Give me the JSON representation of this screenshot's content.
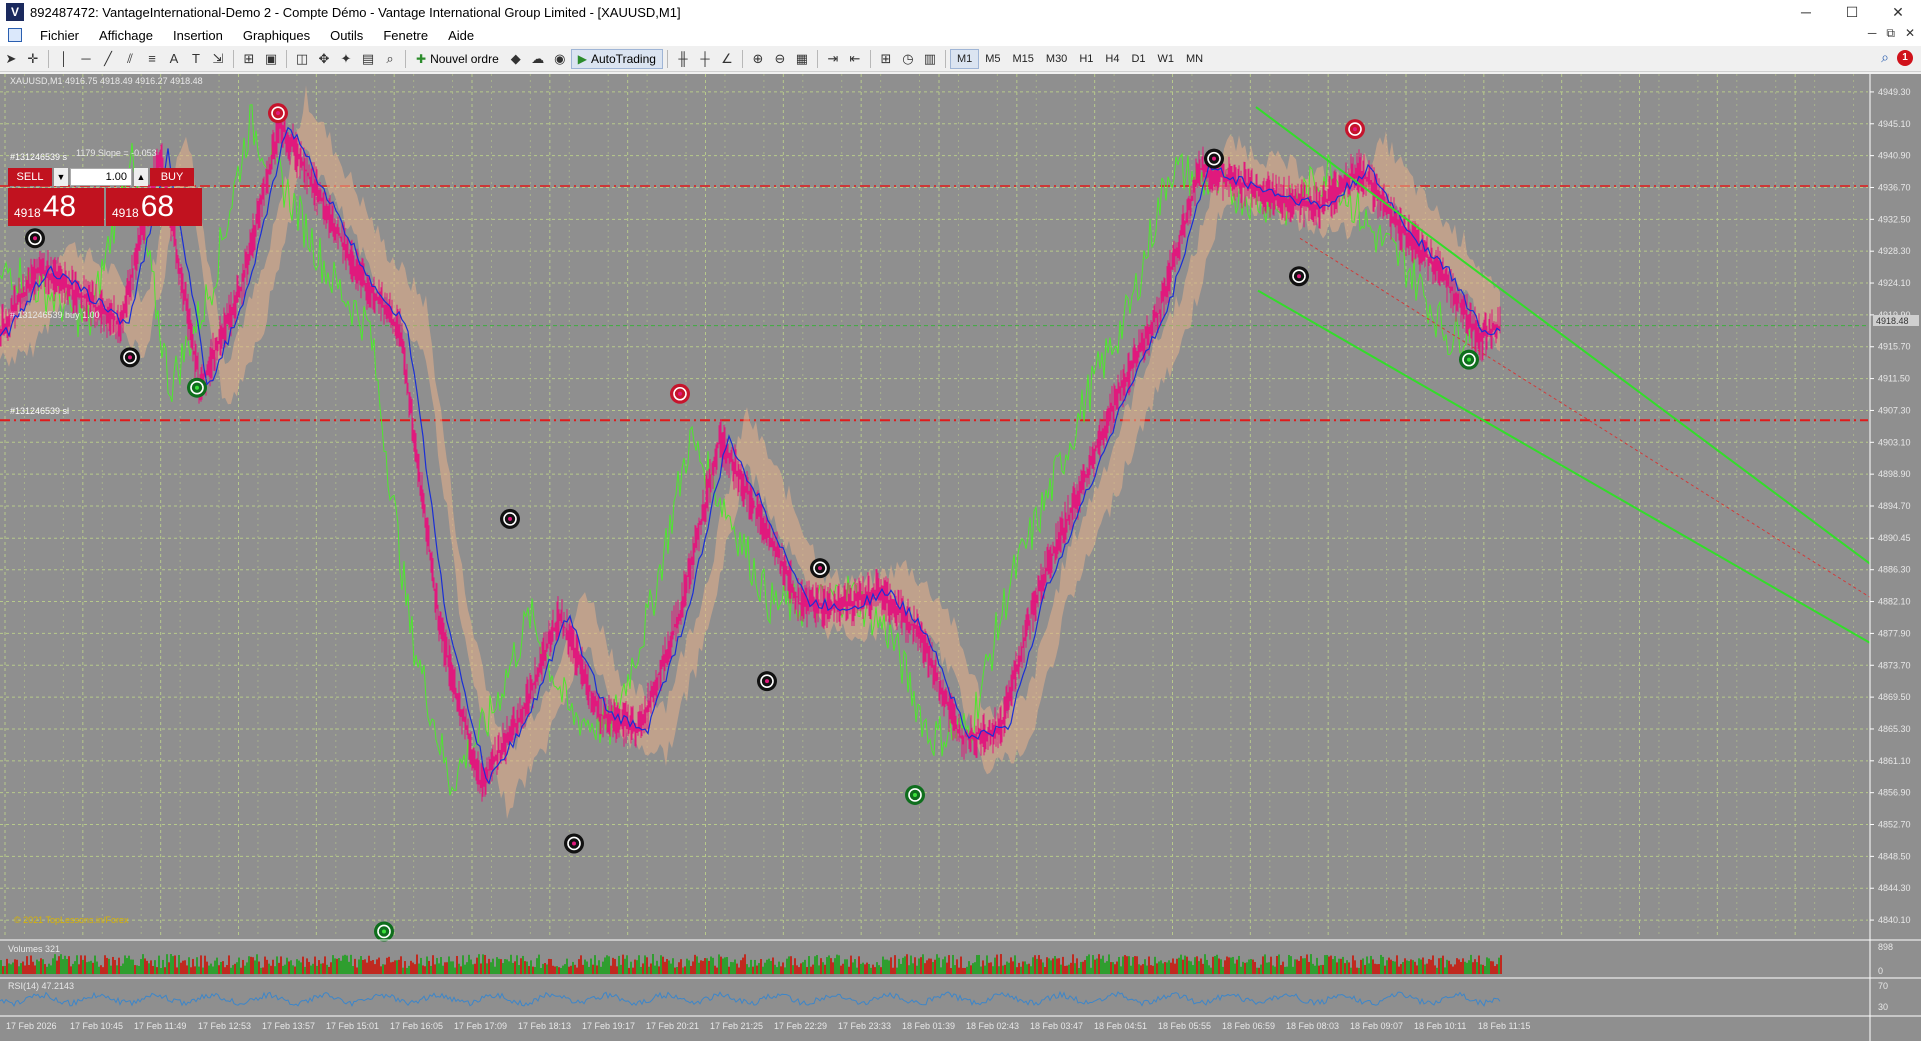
{
  "window": {
    "title": "892487472: VantageInternational-Demo 2 - Compte Démo - Vantage International Group Limited - [XAUUSD,M1]",
    "app_icon_letter": "V",
    "minimize": "─",
    "maximize": "☐",
    "close": "✕"
  },
  "menu": {
    "items": [
      "Fichier",
      "Affichage",
      "Insertion",
      "Graphiques",
      "Outils",
      "Fenetre",
      "Aide"
    ],
    "mdi": [
      "─",
      "⧉",
      "✕"
    ]
  },
  "toolbar": {
    "new_order": "Nouvel ordre",
    "autotrading": "AutoTrading",
    "timeframes": [
      "M1",
      "M5",
      "M15",
      "M30",
      "H1",
      "H4",
      "D1",
      "W1",
      "MN"
    ],
    "active_timeframe": "M1",
    "alert_count": "1"
  },
  "chart": {
    "header": "XAUUSD,M1  4916.75 4918.49 4916.27 4918.48",
    "trend_info": "1179 Slope = -0.053",
    "level_label_1": "#131246539 s",
    "level_label_2": "#131246539 sl",
    "mid_label": "# 131246539 buy 1.00",
    "copyright": "© 2021 TopLessons.in/Forex",
    "current_price_tag": "4918.48",
    "volumes_label": "Volumes 321",
    "rsi_label": "RSI(14) 47.2143",
    "volumes_scale": [
      "898",
      "0"
    ],
    "rsi_scale": [
      "70",
      "30"
    ]
  },
  "trade_panel": {
    "sell_label": "SELL",
    "buy_label": "BUY",
    "lot": "1.00",
    "sell_small": "4918",
    "sell_big": "48",
    "buy_small": "4918",
    "buy_big": "68"
  },
  "chart_data": {
    "type": "line",
    "symbol": "XAUUSD",
    "timeframe": "M1",
    "y_ticks": [
      "4949.30",
      "4945.10",
      "4940.90",
      "4936.70",
      "4932.50",
      "4928.30",
      "4924.10",
      "4919.90",
      "4915.70",
      "4911.50",
      "4907.30",
      "4903.10",
      "4898.90",
      "4894.70",
      "4890.45",
      "4886.30",
      "4882.10",
      "4877.90",
      "4873.70",
      "4869.50",
      "4865.30",
      "4861.10",
      "4856.90",
      "4852.70",
      "4848.50",
      "4844.30",
      "4840.10"
    ],
    "x_ticks": [
      "17 Feb 2026",
      "17 Feb 10:45",
      "17 Feb 11:49",
      "17 Feb 12:53",
      "17 Feb 13:57",
      "17 Feb 15:01",
      "17 Feb 16:05",
      "17 Feb 17:09",
      "17 Feb 18:13",
      "17 Feb 19:17",
      "17 Feb 20:21",
      "17 Feb 21:25",
      "17 Feb 22:29",
      "17 Feb 23:33",
      "18 Feb 01:39",
      "18 Feb 02:43",
      "18 Feb 03:47",
      "18 Feb 04:51",
      "18 Feb 05:55",
      "18 Feb 06:59",
      "18 Feb 08:03",
      "18 Feb 09:07",
      "18 Feb 10:11",
      "18 Feb 11:15"
    ],
    "ylim": [
      4838.0,
      4951.4
    ],
    "colors": {
      "background": "#8f8f8f",
      "grid": "#b7c98b",
      "price": "#e0197d",
      "ma": "#1a2fd6",
      "chikou": "#4de82d",
      "channel": "#33dd2a",
      "sl_line": "#e01b1b",
      "volume_up": "#2f9e2f",
      "volume_down": "#c0291f",
      "rsi": "#3d86c9"
    },
    "series": [
      {
        "x": [
          0,
          40,
          80,
          120,
          160,
          200,
          240,
          280,
          320,
          360,
          400,
          440,
          480,
          520,
          560,
          600,
          640,
          680,
          720,
          760,
          800,
          840,
          880,
          920,
          960,
          1000,
          1040,
          1080,
          1120,
          1160,
          1200,
          1240,
          1280,
          1320,
          1360,
          1400,
          1440,
          1480,
          1500
        ],
        "values": [
          4917.7,
          4926.0,
          4922.6,
          4918.7,
          4941.2,
          4910.4,
          4923.0,
          4945.3,
          4935.4,
          4925.0,
          4918.0,
          4878.6,
          4858.2,
          4866.8,
          4880.3,
          4867.2,
          4865.3,
          4880.8,
          4903.6,
          4893.3,
          4881.9,
          4881.3,
          4883.4,
          4877.9,
          4864.2,
          4865.3,
          4884.4,
          4896.7,
          4910.1,
          4920.6,
          4939.3,
          4937.2,
          4935.4,
          4934.1,
          4939.2,
          4931.2,
          4925.8,
          4916.7,
          4918.5
        ]
      }
    ],
    "swing_markers": [
      {
        "x": 35,
        "y": 4930.0,
        "type": "black"
      },
      {
        "x": 130,
        "y": 4914.3,
        "type": "black"
      },
      {
        "x": 197,
        "y": 4910.3,
        "type": "green"
      },
      {
        "x": 278,
        "y": 4946.5,
        "type": "red"
      },
      {
        "x": 384,
        "y": 4838.6,
        "type": "green"
      },
      {
        "x": 510,
        "y": 4893.0,
        "type": "black"
      },
      {
        "x": 574,
        "y": 4850.2,
        "type": "black"
      },
      {
        "x": 680,
        "y": 4909.5,
        "type": "red"
      },
      {
        "x": 767,
        "y": 4871.6,
        "type": "black"
      },
      {
        "x": 820,
        "y": 4886.5,
        "type": "black"
      },
      {
        "x": 915,
        "y": 4856.6,
        "type": "green"
      },
      {
        "x": 1214,
        "y": 4940.5,
        "type": "black"
      },
      {
        "x": 1299,
        "y": 4925.0,
        "type": "black"
      },
      {
        "x": 1355,
        "y": 4944.4,
        "type": "red"
      },
      {
        "x": 1469,
        "y": 4914.0,
        "type": "green"
      }
    ],
    "horizontal_levels": [
      4936.9,
      4906.0,
      4918.48
    ],
    "channel_lines": [
      {
        "from": [
          1256,
          4947.3
        ],
        "to": [
          1872,
          4886.9
        ]
      },
      {
        "from": [
          1258,
          4923.1
        ],
        "to": [
          1872,
          4876.5
        ]
      }
    ]
  }
}
